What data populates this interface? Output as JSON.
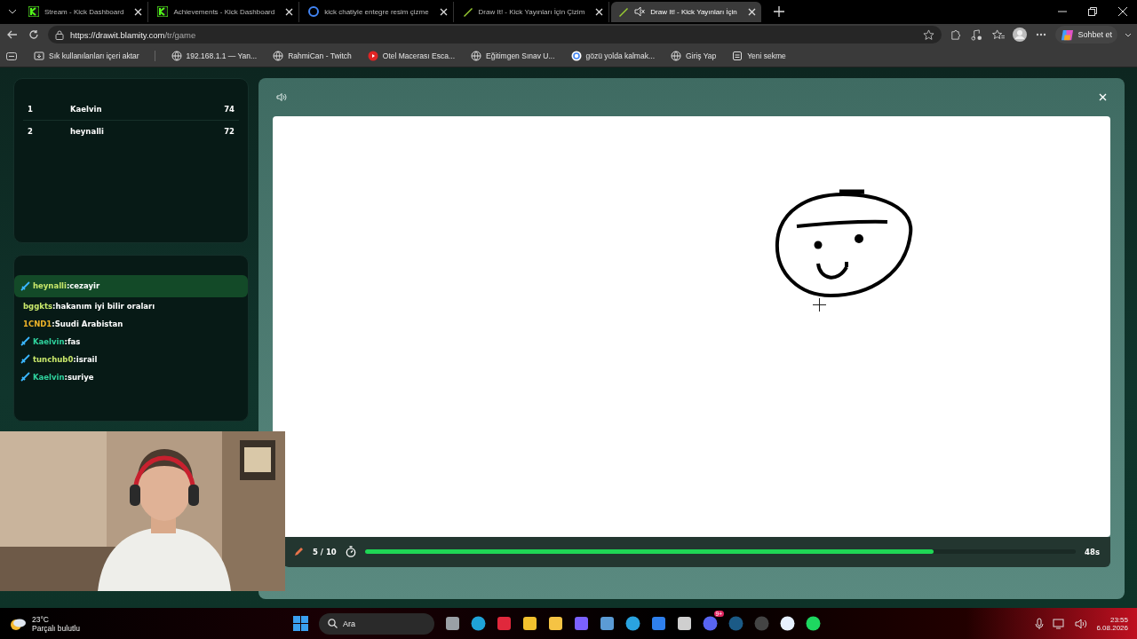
{
  "browser": {
    "tabs": [
      {
        "title": "Stream - Kick Dashboard",
        "selected": false,
        "muted": false
      },
      {
        "title": "Achievements - Kick Dashboard",
        "selected": false,
        "muted": false
      },
      {
        "title": "kick chatiyle entegre resim çizme",
        "selected": false,
        "muted": false
      },
      {
        "title": "Draw It! - Kick Yayınları İçin Çizim",
        "selected": false,
        "muted": false
      },
      {
        "title": "Draw It! - Kick Yayınları İçin",
        "selected": true,
        "muted": true
      }
    ],
    "url_host": "https://drawit.blamity.com",
    "url_path": "/tr/game",
    "profile_button": "Sohbet et",
    "bookmarks": [
      {
        "label": "Sık kullanılanları içeri aktar"
      },
      {
        "label": "192.168.1.1 — Yan..."
      },
      {
        "label": "RahmiCan - Twitch"
      },
      {
        "label": "Otel Macerası Esca..."
      },
      {
        "label": "Eğitimgen Sınav U..."
      },
      {
        "label": "gözü yolda kalmak..."
      },
      {
        "label": "Giriş Yap"
      },
      {
        "label": "Yeni sekme"
      }
    ]
  },
  "leaderboard": [
    {
      "rank": "1",
      "name": "Kaelvin",
      "score": "74"
    },
    {
      "rank": "2",
      "name": "heynalli",
      "score": "72"
    }
  ],
  "chat": [
    {
      "user": "heynalli",
      "text": ":cezayir",
      "color": "#c9e86b",
      "badge": true,
      "highlighted": true
    },
    {
      "user": "bggkts",
      "text": ":hakanım iyi bilir oraları",
      "color": "#c9e86b",
      "badge": false,
      "highlighted": false
    },
    {
      "user": "1CND1",
      "text": ":Suudi Arabistan",
      "color": "#f0b429",
      "badge": false,
      "highlighted": false
    },
    {
      "user": "Kaelvin",
      "text": ":fas",
      "color": "#2fd39e",
      "badge": true,
      "highlighted": false
    },
    {
      "user": "tunchub0",
      "text": ":israil",
      "color": "#c9e86b",
      "badge": true,
      "highlighted": false
    },
    {
      "user": "Kaelvin",
      "text": ":suriye",
      "color": "#2fd39e",
      "badge": true,
      "highlighted": false
    }
  ],
  "game": {
    "round": "5 / 10",
    "level": 0.8,
    "time_left": "48s"
  },
  "taskbar": {
    "temperature": "23°C",
    "weather": "Parçalı bulutlu",
    "search_placeholder": "Ara",
    "time": "23:55",
    "date": "6.08.2026",
    "apps": [
      {
        "kind": "taskview"
      },
      {
        "kind": "edge"
      },
      {
        "kind": "red"
      },
      {
        "kind": "store"
      },
      {
        "kind": "folder"
      },
      {
        "kind": "copilot"
      },
      {
        "kind": "tool"
      },
      {
        "kind": "telegram"
      },
      {
        "kind": "vscode"
      },
      {
        "kind": "app"
      },
      {
        "kind": "discord",
        "badge": "9+"
      },
      {
        "kind": "steam"
      },
      {
        "kind": "obs"
      },
      {
        "kind": "cam"
      },
      {
        "kind": "spotify"
      }
    ]
  }
}
